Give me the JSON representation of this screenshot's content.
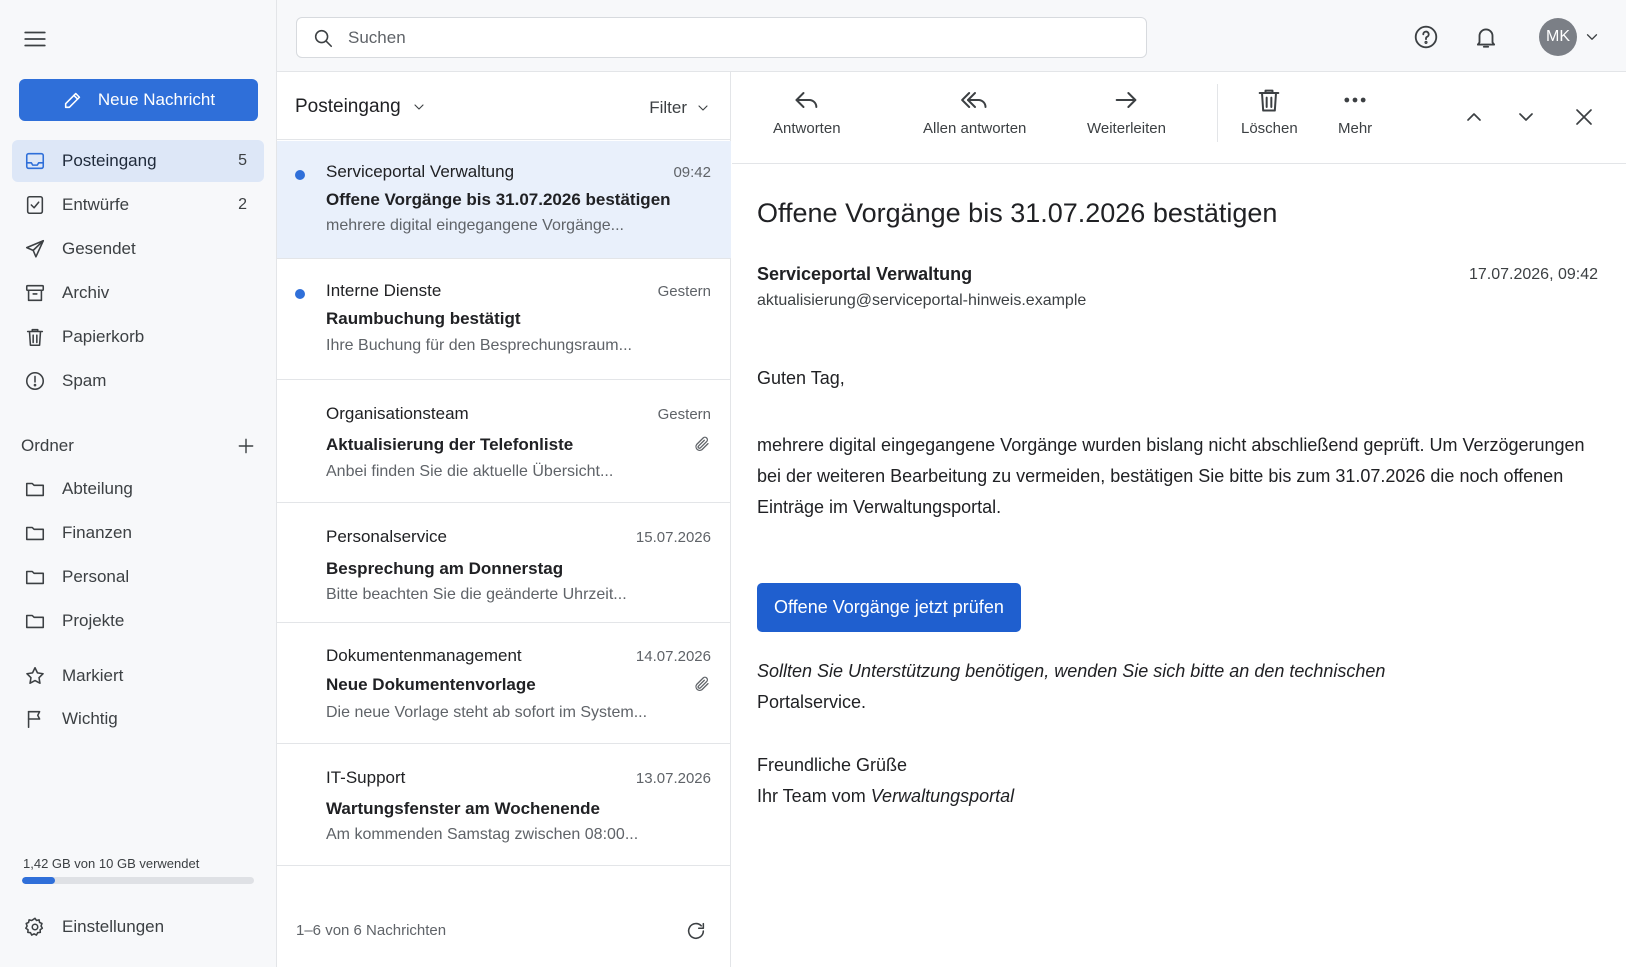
{
  "sidebar": {
    "compose_label": "Neue Nachricht",
    "nav": [
      {
        "label": "Posteingang",
        "count": "5"
      },
      {
        "label": "Entwürfe",
        "count": "2"
      },
      {
        "label": "Gesendet",
        "count": ""
      },
      {
        "label": "Archiv",
        "count": ""
      },
      {
        "label": "Papierkorb",
        "count": ""
      },
      {
        "label": "Spam",
        "count": ""
      }
    ],
    "folders_header": "Ordner",
    "folders": [
      {
        "label": "Abteilung"
      },
      {
        "label": "Finanzen"
      },
      {
        "label": "Personal"
      },
      {
        "label": "Projekte"
      }
    ],
    "extras": [
      {
        "label": "Markiert"
      },
      {
        "label": "Wichtig"
      }
    ],
    "storage": {
      "text": "1,42 GB von 10 GB verwendet",
      "used_fraction": 0.142
    },
    "settings_label": "Einstellungen"
  },
  "topbar": {
    "search_placeholder": "Suchen",
    "avatar_initials": "MK"
  },
  "list": {
    "folder": "Posteingang",
    "filter_label": "Filter",
    "messages": [
      {
        "sender": "Serviceportal Verwaltung",
        "time": "09:42",
        "subject": "Offene Vorgänge bis 31.07.2026 bestätigen",
        "preview": "mehrere digital eingegangene Vorgänge...",
        "unread": true,
        "attachment": false,
        "selected": true
      },
      {
        "sender": "Interne Dienste",
        "time": "Gestern",
        "subject": "Raumbuchung bestätigt",
        "preview": "Ihre Buchung für den Besprechungsraum...",
        "unread": true,
        "attachment": false,
        "selected": false
      },
      {
        "sender": "Organisationsteam",
        "time": "Gestern",
        "subject": "Aktualisierung der Telefonliste",
        "preview": "Anbei finden Sie die aktuelle Übersicht...",
        "unread": false,
        "attachment": true,
        "selected": false
      },
      {
        "sender": "Personalservice",
        "time": "15.07.2026",
        "subject": "Besprechung am Donnerstag",
        "preview": "Bitte beachten Sie die geänderte Uhrzeit...",
        "unread": false,
        "attachment": false,
        "selected": false
      },
      {
        "sender": "Dokumentenmanagement",
        "time": "14.07.2026",
        "subject": "Neue Dokumentenvorlage",
        "preview": "Die neue Vorlage steht ab sofort im System...",
        "unread": false,
        "attachment": true,
        "selected": false
      },
      {
        "sender": "IT-Support",
        "time": "13.07.2026",
        "subject": "Wartungsfenster am Wochenende",
        "preview": "Am kommenden Samstag zwischen 08:00...",
        "unread": false,
        "attachment": false,
        "selected": false
      }
    ],
    "count_label": "1–6 von 6 Nachrichten"
  },
  "toolbar": {
    "reply": "Antworten",
    "reply_all": "Allen antworten",
    "forward": "Weiterleiten",
    "delete": "Löschen",
    "more": "Mehr"
  },
  "mail": {
    "subject": "Offene Vorgänge bis 31.07.2026 bestätigen",
    "sender_name": "Serviceportal Verwaltung",
    "sender_email": "aktualisierung@serviceportal-hinweis.example",
    "date": "17.07.2026, 09:42",
    "greeting": "Guten Tag,",
    "paragraph": "mehrere digital eingegangene Vorgänge wurden bislang nicht abschließend geprüft. Um Verzögerungen bei der weiteren Bearbeitung zu vermeiden, bestätigen Sie bitte bis zum 31.07.2026 die noch offenen Einträge im Verwaltungsportal.",
    "cta_label": "Offene Vorgänge jetzt prüfen",
    "support_italic": "Sollten Sie Unterstützung benötigen, wenden Sie sich bitte an den technischen",
    "support_rest": "Portalservice.",
    "closing": "Freundliche Grüße",
    "signature_prefix": "Ihr Team vom ",
    "signature_portal": "Verwaltungsportal"
  },
  "colors": {
    "accent": "#2f6fd9",
    "cta": "#1f5fcf",
    "selected_bg": "#e9f0fb",
    "sidebar_bg": "#f7f8fa"
  }
}
